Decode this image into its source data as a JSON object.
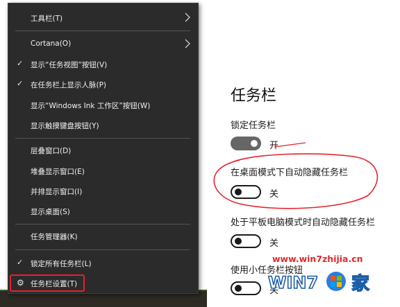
{
  "context_menu": {
    "items": [
      {
        "label": "工具栏(T)",
        "check": false,
        "submenu": true
      },
      {
        "label": "Cortana(O)",
        "check": false,
        "submenu": true
      },
      {
        "label": "显示“任务视图”按钮(V)",
        "check": true,
        "submenu": false
      },
      {
        "label": "在任务栏上显示人脉(P)",
        "check": true,
        "submenu": false
      },
      {
        "label": "显示“Windows Ink 工作区”按钮(W)",
        "check": false,
        "submenu": false
      },
      {
        "label": "显示触摸键盘按钮(Y)",
        "check": false,
        "submenu": false
      },
      {
        "label": "层叠窗口(D)",
        "check": false,
        "submenu": false
      },
      {
        "label": "堆叠显示窗口(E)",
        "check": false,
        "submenu": false
      },
      {
        "label": "并排显示窗口(I)",
        "check": false,
        "submenu": false
      },
      {
        "label": "显示桌面(S)",
        "check": false,
        "submenu": false
      },
      {
        "label": "任务管理器(K)",
        "check": false,
        "submenu": false
      },
      {
        "label": "锁定所有任务栏(L)",
        "check": true,
        "submenu": false
      },
      {
        "label": "任务栏设置(T)",
        "check": false,
        "submenu": false,
        "icon": "gear-icon",
        "highlighted": true
      }
    ]
  },
  "settings": {
    "title": "任务栏",
    "options": [
      {
        "label": "锁定任务栏",
        "state": "开",
        "on": true
      },
      {
        "label": "在桌面模式下自动隐藏任务栏",
        "state": "关",
        "on": false,
        "circled": true
      },
      {
        "label": "处于平板电脑模式时自动隐藏任务栏",
        "state": "关",
        "on": false
      },
      {
        "label": "使用小任务栏按钮",
        "state": "关",
        "on": false
      }
    ]
  },
  "watermark": {
    "url": "www.win7zhijia.cn",
    "logo_text_left": "WIN7",
    "logo_text_right": "家"
  },
  "colors": {
    "menu_bg": "#2b2b2b",
    "menu_text": "#f2f2f2",
    "highlight_red": "#e5232b",
    "toggle_on": "#666666"
  }
}
